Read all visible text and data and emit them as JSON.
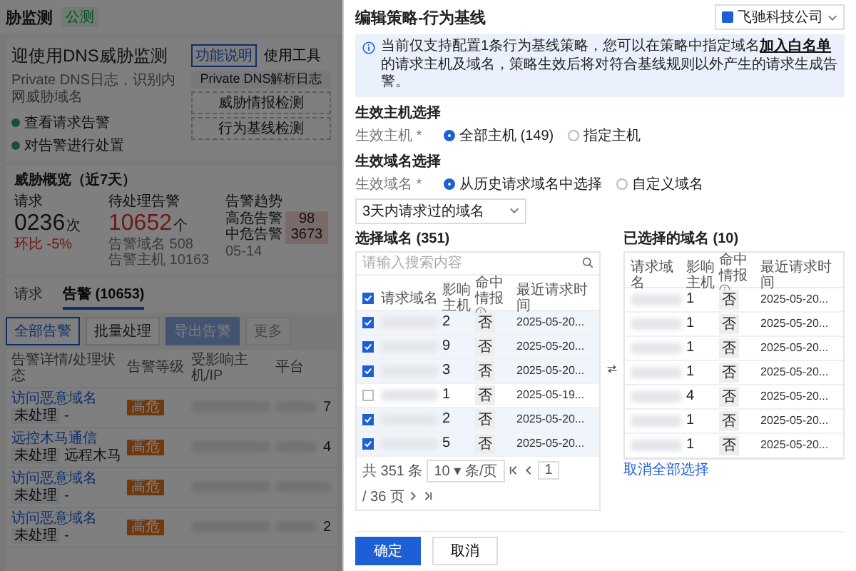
{
  "background": {
    "header": {
      "title": "胁监测",
      "tag": "公测"
    },
    "hero": {
      "title": "迎使用DNS威胁监测",
      "description": "Private DNS日志，识别内网威胁域名",
      "steps": [
        "查看请求告警",
        "对告警进行处置"
      ],
      "tabs": [
        {
          "label": "功能说明",
          "selected": true
        },
        {
          "label": "使用工具",
          "selected": false
        }
      ],
      "diagram": {
        "source": "Private DNS解析日志",
        "outputs": [
          "威胁情报检测",
          "行为基线检测"
        ]
      }
    },
    "overview": {
      "title": "威胁概览（近7天）",
      "cards": [
        {
          "label": "请求",
          "value": "0236",
          "unit": "次",
          "notes": [
            "环比 -5%"
          ],
          "alert": false
        },
        {
          "label": "待处理告警",
          "value": "10652",
          "unit": "个",
          "notes": [
            "告警域名 508",
            "告警主机 10163"
          ],
          "alert": true
        }
      ],
      "trend": {
        "title": "告警趋势",
        "rows": [
          {
            "label": "高危告警",
            "value": "98"
          },
          {
            "label": "中危告警",
            "value": "3673"
          }
        ],
        "date": "05-14"
      }
    },
    "tabs": [
      {
        "label": "请求",
        "selected": false
      },
      {
        "label": "告警 (10653)",
        "selected": true
      }
    ],
    "toolbar": [
      {
        "label": "全部告警",
        "kind": "outline",
        "disabled": false
      },
      {
        "label": "批量处理",
        "kind": "plain",
        "disabled": false
      },
      {
        "label": "导出告警",
        "kind": "primary",
        "disabled": true
      },
      {
        "label": "更多",
        "kind": "plain",
        "disabled": true
      }
    ],
    "table": {
      "columns": [
        "告警详情/处理状态",
        "告警等级",
        "受影响主机/IP",
        "平台"
      ],
      "rows": [
        {
          "link": "访问恶意域名",
          "tag": "未处理",
          "extra": "-",
          "level": "高危",
          "count": "7"
        },
        {
          "link": "远控木马通信",
          "tag": "未处理",
          "extra": "远程木马",
          "level": "高危",
          "count": "4"
        },
        {
          "link": "访问恶意域名",
          "tag": "未处理",
          "extra": "-",
          "level": "高危"
        },
        {
          "link": "访问恶意域名",
          "tag": "未处理",
          "extra": "-",
          "level": "高危",
          "count": "2"
        }
      ]
    }
  },
  "drawer": {
    "title": "编辑策略-行为基线",
    "org_select": "飞驰科技公司",
    "notice": {
      "before": "当前仅支持配置1条行为基线策略，您可以在策略中指定域名",
      "link": "加入白名单",
      "after": "的请求主机及域名，策略生效后将对符合基线规则以外产生的请求生成告警。"
    },
    "host_section": {
      "title": "生效主机选择",
      "label": "生效主机 *",
      "options": [
        {
          "label": "全部主机 (149)",
          "selected": true
        },
        {
          "label": "指定主机",
          "selected": false
        }
      ]
    },
    "domain_section": {
      "title": "生效域名选择",
      "label": "生效域名 *",
      "options": [
        {
          "label": "从历史请求域名中选择",
          "selected": true
        },
        {
          "label": "自定义域名",
          "selected": false
        }
      ],
      "range_select": "3天内请求过的域名"
    },
    "available": {
      "title": "选择域名 (351)",
      "search_placeholder": "请输入搜索内容",
      "all_checked": true,
      "columns": [
        "请求域名",
        "影响主机",
        "命中情报",
        "最近请求时间"
      ],
      "rows": [
        {
          "checked": true,
          "hosts": "2",
          "intel": "否",
          "time": "2025-05-20..."
        },
        {
          "checked": true,
          "hosts": "9",
          "intel": "否",
          "time": "2025-05-20..."
        },
        {
          "checked": true,
          "hosts": "3",
          "intel": "否",
          "time": "2025-05-20..."
        },
        {
          "checked": false,
          "hosts": "1",
          "intel": "否",
          "time": "2025-05-19..."
        },
        {
          "checked": true,
          "hosts": "2",
          "intel": "否",
          "time": "2025-05-20..."
        },
        {
          "checked": true,
          "hosts": "5",
          "intel": "否",
          "time": "2025-05-20..."
        }
      ],
      "pagination": {
        "total": "共 351 条",
        "page_size": "10 ▾ 条/页",
        "page": "1",
        "pages": "/ 36 页"
      }
    },
    "selected": {
      "title": "已选择的域名 (10)",
      "columns": [
        "请求域名",
        "影响主机",
        "命中情报",
        "最近请求时间"
      ],
      "rows": [
        {
          "hosts": "1",
          "intel": "否",
          "time": "2025-05-20..."
        },
        {
          "hosts": "1",
          "intel": "否",
          "time": "2025-05-20..."
        },
        {
          "hosts": "1",
          "intel": "否",
          "time": "2025-05-20..."
        },
        {
          "hosts": "1",
          "intel": "否",
          "time": "2025-05-20..."
        },
        {
          "hosts": "4",
          "intel": "否",
          "time": "2025-05-20..."
        },
        {
          "hosts": "1",
          "intel": "否",
          "time": "2025-05-20..."
        },
        {
          "hosts": "1",
          "intel": "否",
          "time": "2025-05-20..."
        }
      ]
    },
    "clear_link": "取消全部选择",
    "buttons": [
      {
        "label": "确定",
        "kind": "primary"
      },
      {
        "label": "取消",
        "kind": "secondary"
      }
    ]
  }
}
